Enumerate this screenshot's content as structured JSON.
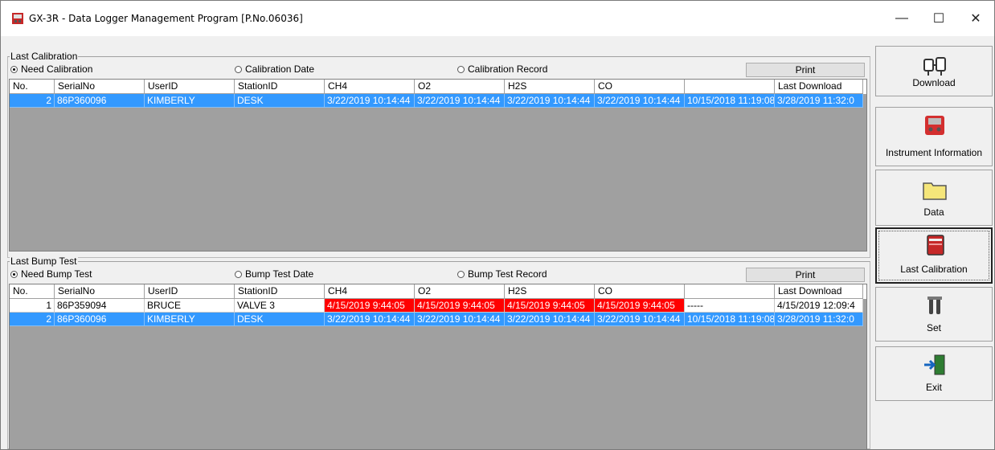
{
  "window": {
    "title": "GX-3R - Data Logger Management Program [P.No.06036]",
    "minimize": "—",
    "maximize": "☐",
    "close": "✕"
  },
  "calibration": {
    "group_label": "Last Calibration",
    "radio_need": "Need Calibration",
    "radio_date": "Calibration Date",
    "radio_record": "Calibration Record",
    "print": "Print",
    "columns": [
      "No.",
      "SerialNo",
      "UserID",
      "StationID",
      "CH4",
      "O2",
      "H2S",
      "CO",
      "",
      "Last Download"
    ],
    "rows": [
      {
        "no": "2",
        "serial": "86P360096",
        "user": "KIMBERLY",
        "station": "DESK",
        "ch4": "3/22/2019 10:14:44",
        "o2": "3/22/2019 10:14:44",
        "h2s": "3/22/2019 10:14:44",
        "co": "3/22/2019 10:14:44",
        "extra": "10/15/2018 11:19:08",
        "last": "3/28/2019 11:32:0"
      }
    ]
  },
  "bump": {
    "group_label": "Last Bump Test",
    "radio_need": "Need Bump Test",
    "radio_date": "Bump Test Date",
    "radio_record": "Bump Test Record",
    "print": "Print",
    "columns": [
      "No.",
      "SerialNo",
      "UserID",
      "StationID",
      "CH4",
      "O2",
      "H2S",
      "CO",
      "",
      "Last Download"
    ],
    "rows": [
      {
        "no": "1",
        "serial": "86P359094",
        "user": "BRUCE",
        "station": "VALVE 3",
        "ch4": "4/15/2019 9:44:05",
        "o2": "4/15/2019 9:44:05",
        "h2s": "4/15/2019 9:44:05",
        "co": "4/15/2019 9:44:05",
        "extra": "-----",
        "last": "4/15/2019 12:09:4"
      },
      {
        "no": "2",
        "serial": "86P360096",
        "user": "KIMBERLY",
        "station": "DESK",
        "ch4": "3/22/2019 10:14:44",
        "o2": "3/22/2019 10:14:44",
        "h2s": "3/22/2019 10:14:44",
        "co": "3/22/2019 10:14:44",
        "extra": "10/15/2018 11:19:08",
        "last": "3/28/2019 11:32:0"
      }
    ]
  },
  "sidebar": {
    "download": "Download",
    "instrument": "Instrument Information",
    "data": "Data",
    "last_calibration": "Last Calibration",
    "set": "Set",
    "exit": "Exit"
  },
  "colors": {
    "selection": "#3399ff",
    "overdue": "#ff0000",
    "grid_bg": "#a0a0a0"
  }
}
